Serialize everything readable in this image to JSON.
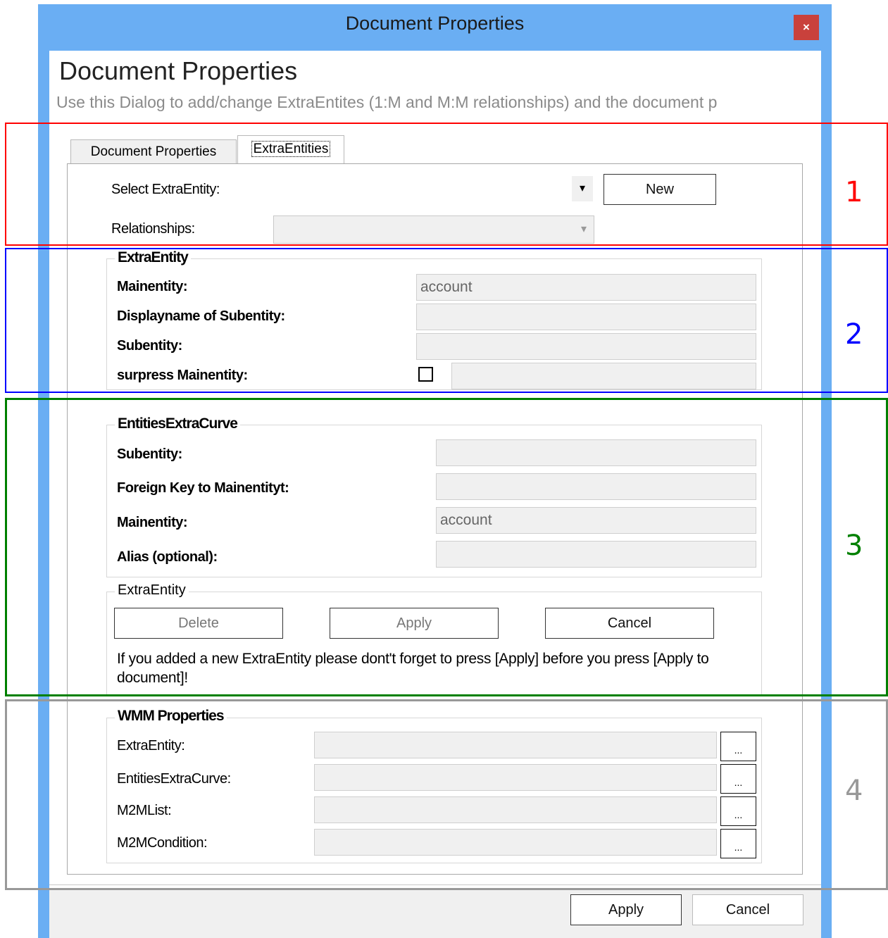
{
  "window": {
    "title": "Document Properties",
    "close_label": "×"
  },
  "header": {
    "title": "Document Properties",
    "subtitle": "Use this Dialog to add/change ExtraEntites (1:M and M:M relationships) and the document p"
  },
  "tabs": [
    {
      "label": "Document Properties"
    },
    {
      "label": "ExtraEntities"
    }
  ],
  "select_section": {
    "select_label": "Select ExtraEntity:",
    "dropdown_arrow": "▾",
    "new_button": "New",
    "relationships_label": "Relationships:",
    "relationships_arrow": "▾"
  },
  "extra_entity": {
    "title": "ExtraEntity",
    "mainentity_label": "Mainentity:",
    "mainentity_value": "account",
    "displayname_label": "Displayname of Subentity:",
    "subentity_label": "Subentity:",
    "surpress_label": "surpress Mainentity:"
  },
  "entities_extra_curve": {
    "title": "EntitiesExtraCurve",
    "subentity_label": "Subentity:",
    "foreign_key_label": "Foreign Key to Mainentityt:",
    "mainentity_label": "Mainentity:",
    "mainentity_value": "account",
    "alias_label": "Alias (optional):"
  },
  "extra_entity_actions": {
    "title": "ExtraEntity",
    "delete": "Delete",
    "apply": "Apply",
    "cancel": "Cancel",
    "note": "If you added a new ExtraEntity please dont't forget to press [Apply] before you press [Apply to document]!"
  },
  "wmm": {
    "title": "WMM Properties",
    "rows": [
      {
        "label": "ExtraEntity:",
        "button": "..."
      },
      {
        "label": "EntitiesExtraCurve:",
        "button": "..."
      },
      {
        "label": "M2MList:",
        "button": "..."
      },
      {
        "label": "M2MCondition:",
        "button": "..."
      }
    ]
  },
  "footer": {
    "apply": "Apply",
    "cancel": "Cancel"
  },
  "annotations": [
    {
      "label": "1",
      "color": "#ff0000"
    },
    {
      "label": "2",
      "color": "#0000ff"
    },
    {
      "label": "3",
      "color": "#008000"
    },
    {
      "label": "4",
      "color": "#999999"
    }
  ]
}
